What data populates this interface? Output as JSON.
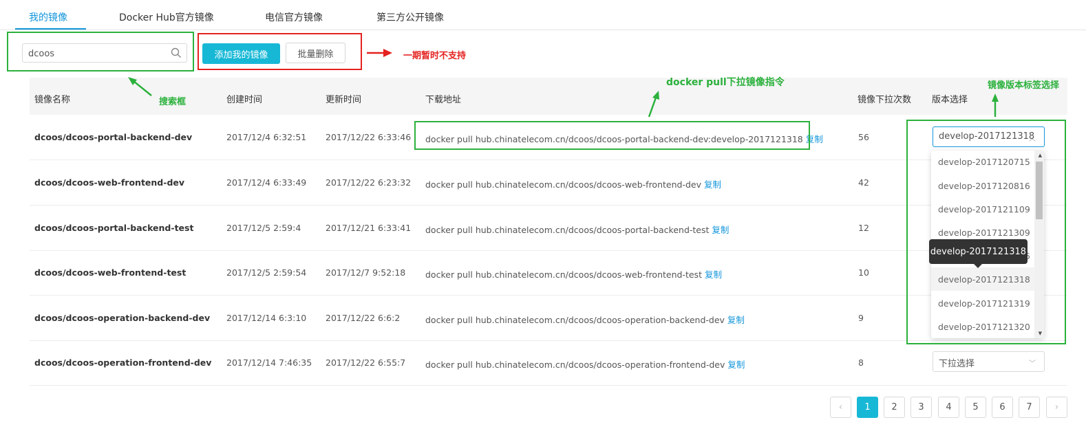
{
  "tabs": [
    "我的镜像",
    "Docker Hub官方镜像",
    "电信官方镜像",
    "第三方公开镜像"
  ],
  "search": {
    "value": "dcoos"
  },
  "buttons": {
    "add": "添加我的镜像",
    "batch_delete": "批量删除"
  },
  "annotations": {
    "not_supported": "一期暂时不支持",
    "search_box": "搜索框",
    "docker_pull": "docker pull下拉镜像指令",
    "version_select": "镜像版本标签选择"
  },
  "table": {
    "headers": [
      "镜像名称",
      "创建时间",
      "更新时间",
      "下载地址",
      "镜像下拉次数",
      "版本选择"
    ],
    "copy_label": "复制",
    "rows": [
      {
        "name": "dcoos/dcoos-portal-backend-dev",
        "created": "2017/12/4 6:32:51",
        "updated": "2017/12/22 6:33:46",
        "pull": "docker pull hub.chinatelecom.cn/dcoos/dcoos-portal-backend-dev:develop-2017121318",
        "count": "56",
        "version": "develop-2017121318"
      },
      {
        "name": "dcoos/dcoos-web-frontend-dev",
        "created": "2017/12/4 6:33:49",
        "updated": "2017/12/22 6:23:32",
        "pull": "docker pull hub.chinatelecom.cn/dcoos/dcoos-web-frontend-dev",
        "count": "42",
        "version": ""
      },
      {
        "name": "dcoos/dcoos-portal-backend-test",
        "created": "2017/12/5 2:59:4",
        "updated": "2017/12/21 6:33:41",
        "pull": "docker pull hub.chinatelecom.cn/dcoos/dcoos-portal-backend-test",
        "count": "12",
        "version": ""
      },
      {
        "name": "dcoos/dcoos-web-frontend-test",
        "created": "2017/12/5 2:59:54",
        "updated": "2017/12/7 9:52:18",
        "pull": "docker pull hub.chinatelecom.cn/dcoos/dcoos-web-frontend-test",
        "count": "10",
        "version": ""
      },
      {
        "name": "dcoos/dcoos-operation-backend-dev",
        "created": "2017/12/14 6:3:10",
        "updated": "2017/12/22 6:6:2",
        "pull": "docker pull hub.chinatelecom.cn/dcoos/dcoos-operation-backend-dev",
        "count": "9",
        "version": ""
      },
      {
        "name": "dcoos/dcoos-operation-frontend-dev",
        "created": "2017/12/14 7:46:35",
        "updated": "2017/12/22 6:55:7",
        "pull": "docker pull hub.chinatelecom.cn/dcoos/dcoos-operation-frontend-dev",
        "count": "8",
        "version": "下拉选择"
      }
    ]
  },
  "dropdown": {
    "options": [
      "develop-2017120715",
      "develop-2017120816",
      "develop-2017121109",
      "develop-2017121309",
      "develop-2017121316",
      "develop-2017121318",
      "develop-2017121319",
      "develop-2017121320"
    ],
    "highlighted": "develop-2017121318",
    "tooltip": "develop-2017121318"
  },
  "pagination": {
    "pages": [
      "1",
      "2",
      "3",
      "4",
      "5",
      "6",
      "7"
    ],
    "current": "1",
    "prev": "‹",
    "next": "›"
  },
  "colors": {
    "accent": "#17b8d6",
    "link": "#1296db",
    "annotation_green": "#2bb13c",
    "annotation_red": "#e42220"
  }
}
